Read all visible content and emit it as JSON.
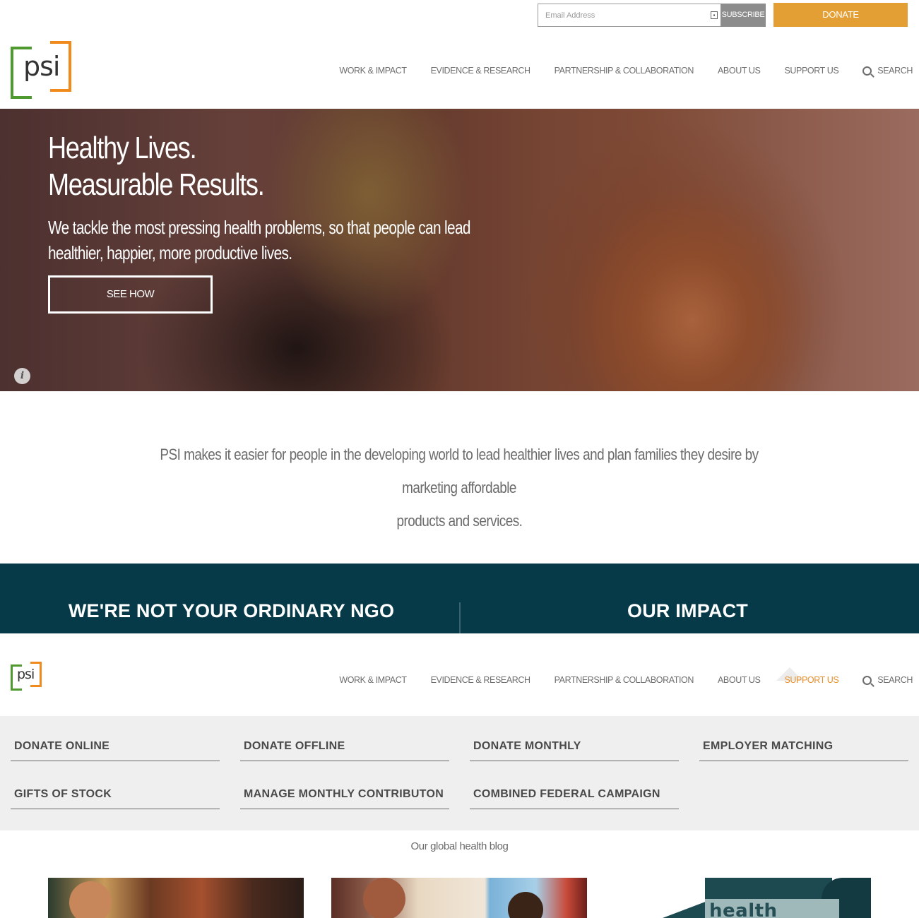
{
  "utility": {
    "email_placeholder": "Email Address",
    "subscribe_label": "SUBSCRIBE",
    "donate_label": "DONATE"
  },
  "logo": {
    "text": "psi"
  },
  "nav": {
    "items": [
      "WORK & IMPACT",
      "EVIDENCE & RESEARCH",
      "PARTNERSHIP & COLLABORATION",
      "ABOUT US",
      "SUPPORT US"
    ],
    "search_label": "SEARCH"
  },
  "hero": {
    "title_line1": "Healthy Lives.",
    "title_line2": "Measurable Results.",
    "subtitle_line1": "We tackle the most pressing health problems, so that people can lead",
    "subtitle_line2": "healthier, happier, more productive lives.",
    "cta_label": "SEE HOW",
    "info_icon": "i"
  },
  "mission": {
    "line1": "PSI makes it easier for people in the developing world to lead healthier lives and plan families they desire by marketing affordable",
    "line2": "products and services."
  },
  "band": {
    "left_label": "WE'RE NOT YOUR ORDINARY NGO",
    "right_label": "OUR IMPACT"
  },
  "support_menu": {
    "active_item": "SUPPORT US",
    "items": [
      "DONATE ONLINE",
      "DONATE OFFLINE",
      "DONATE MONTHLY",
      "EMPLOYER MATCHING",
      "GIFTS OF STOCK",
      "MANAGE MONTHLY CONTRIBUTON",
      "COMBINED FEDERAL CAMPAIGN"
    ]
  },
  "blog": {
    "label": "Our global health blog",
    "thumb3_sign": "health clinic"
  },
  "colors": {
    "donate": "#e49f34",
    "band": "#063a48",
    "active_nav": "#e8902c",
    "logo_green": "#4e9a2f",
    "logo_orange": "#f08a1d"
  }
}
